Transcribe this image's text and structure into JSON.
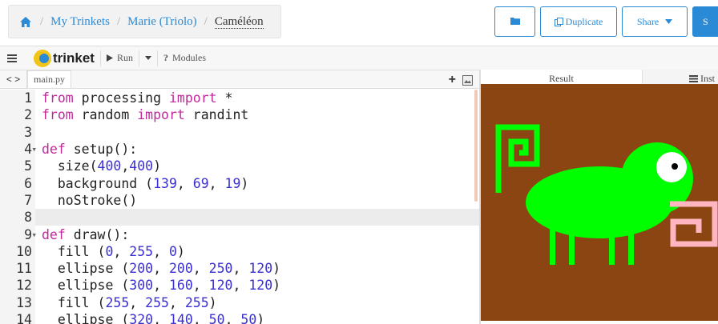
{
  "breadcrumb": {
    "items": [
      "My Trinkets",
      "Marie (Triolo)"
    ],
    "current": "Caméléon",
    "separator": "/"
  },
  "header_buttons": {
    "duplicate": "Duplicate",
    "share": "Share",
    "save": "S"
  },
  "toolbar": {
    "logo": "trinket",
    "run": "Run",
    "modules": "Modules"
  },
  "editor": {
    "nav": "< >",
    "filename": "main.py",
    "add_icon": "+",
    "active_line": 8,
    "lines": [
      {
        "n": "1",
        "fold": "",
        "tokens": [
          {
            "t": "from",
            "c": "kw"
          },
          {
            "t": " processing ",
            "c": ""
          },
          {
            "t": "import",
            "c": "kw"
          },
          {
            "t": " *",
            "c": ""
          }
        ]
      },
      {
        "n": "2",
        "fold": "",
        "tokens": [
          {
            "t": "from",
            "c": "kw"
          },
          {
            "t": " random ",
            "c": ""
          },
          {
            "t": "import",
            "c": "kw"
          },
          {
            "t": " randint",
            "c": ""
          }
        ]
      },
      {
        "n": "3",
        "fold": "",
        "tokens": []
      },
      {
        "n": "4",
        "fold": "▾",
        "tokens": [
          {
            "t": "def",
            "c": "kw"
          },
          {
            "t": " setup():",
            "c": ""
          }
        ]
      },
      {
        "n": "5",
        "fold": "",
        "tokens": [
          {
            "t": "  size(",
            "c": ""
          },
          {
            "t": "400",
            "c": "num"
          },
          {
            "t": ",",
            "c": ""
          },
          {
            "t": "400",
            "c": "num"
          },
          {
            "t": ")",
            "c": ""
          }
        ]
      },
      {
        "n": "6",
        "fold": "",
        "tokens": [
          {
            "t": "  background (",
            "c": ""
          },
          {
            "t": "139",
            "c": "num"
          },
          {
            "t": ", ",
            "c": ""
          },
          {
            "t": "69",
            "c": "num"
          },
          {
            "t": ", ",
            "c": ""
          },
          {
            "t": "19",
            "c": "num"
          },
          {
            "t": ")",
            "c": ""
          }
        ]
      },
      {
        "n": "7",
        "fold": "",
        "tokens": [
          {
            "t": "  noStroke()",
            "c": ""
          }
        ]
      },
      {
        "n": "8",
        "fold": "",
        "tokens": []
      },
      {
        "n": "9",
        "fold": "▾",
        "tokens": [
          {
            "t": "def",
            "c": "kw"
          },
          {
            "t": " draw():",
            "c": ""
          }
        ]
      },
      {
        "n": "10",
        "fold": "",
        "tokens": [
          {
            "t": "  fill (",
            "c": ""
          },
          {
            "t": "0",
            "c": "num"
          },
          {
            "t": ", ",
            "c": ""
          },
          {
            "t": "255",
            "c": "num"
          },
          {
            "t": ", ",
            "c": ""
          },
          {
            "t": "0",
            "c": "num"
          },
          {
            "t": ")",
            "c": ""
          }
        ]
      },
      {
        "n": "11",
        "fold": "",
        "tokens": [
          {
            "t": "  ellipse (",
            "c": ""
          },
          {
            "t": "200",
            "c": "num"
          },
          {
            "t": ", ",
            "c": ""
          },
          {
            "t": "200",
            "c": "num"
          },
          {
            "t": ", ",
            "c": ""
          },
          {
            "t": "250",
            "c": "num"
          },
          {
            "t": ", ",
            "c": ""
          },
          {
            "t": "120",
            "c": "num"
          },
          {
            "t": ")",
            "c": ""
          }
        ]
      },
      {
        "n": "12",
        "fold": "",
        "tokens": [
          {
            "t": "  ellipse (",
            "c": ""
          },
          {
            "t": "300",
            "c": "num"
          },
          {
            "t": ", ",
            "c": ""
          },
          {
            "t": "160",
            "c": "num"
          },
          {
            "t": ", ",
            "c": ""
          },
          {
            "t": "120",
            "c": "num"
          },
          {
            "t": ", ",
            "c": ""
          },
          {
            "t": "120",
            "c": "num"
          },
          {
            "t": ")",
            "c": ""
          }
        ]
      },
      {
        "n": "13",
        "fold": "",
        "tokens": [
          {
            "t": "  fill (",
            "c": ""
          },
          {
            "t": "255",
            "c": "num"
          },
          {
            "t": ", ",
            "c": ""
          },
          {
            "t": "255",
            "c": "num"
          },
          {
            "t": ", ",
            "c": ""
          },
          {
            "t": "255",
            "c": "num"
          },
          {
            "t": ")",
            "c": ""
          }
        ]
      },
      {
        "n": "14",
        "fold": "",
        "tokens": [
          {
            "t": "  ellipse (",
            "c": ""
          },
          {
            "t": "320",
            "c": "num"
          },
          {
            "t": ", ",
            "c": ""
          },
          {
            "t": "140",
            "c": "num"
          },
          {
            "t": ", ",
            "c": ""
          },
          {
            "t": "50",
            "c": "num"
          },
          {
            "t": ", ",
            "c": ""
          },
          {
            "t": "50",
            "c": "num"
          },
          {
            "t": ")",
            "c": ""
          }
        ]
      }
    ]
  },
  "result": {
    "tab_result": "Result",
    "tab_instructions": "Inst",
    "canvas_background": "#8B4513",
    "body_color": "#00FF00",
    "eye_color": "#FFFFFF",
    "pupil_color": "#000000",
    "tongue_color": "#FFB6C1"
  },
  "colors": {
    "accent": "#2b8ad6",
    "keyword": "#c0289a",
    "number": "#3a2fd0"
  }
}
